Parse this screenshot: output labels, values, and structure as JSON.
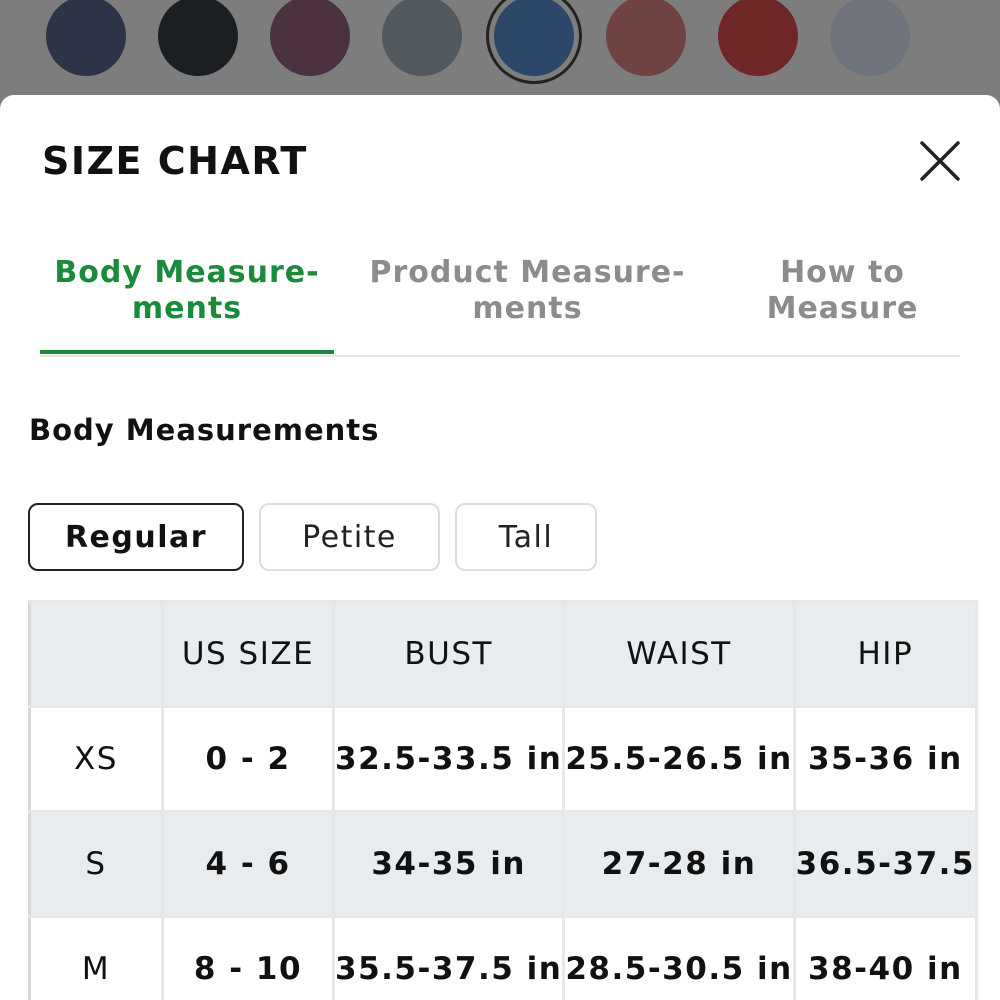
{
  "colors": {
    "accent": "#1a8a3c",
    "swatches": [
      "#2e3448",
      "#1c1f21",
      "#4c3140",
      "#51595f",
      "#2c4869",
      "#6e4342",
      "#6f2627",
      "#6f737b"
    ]
  },
  "swatches": {
    "selected_index": 4
  },
  "size_chart": {
    "title": "SIZE CHART",
    "close_icon": "close-icon"
  },
  "tabs": [
    {
      "label": "Body Measure-\nments",
      "active": true
    },
    {
      "label": "Product Measure-\nments",
      "active": false
    },
    {
      "label": "How to\nMeasure",
      "active": false
    }
  ],
  "section_title": "Body Measurements",
  "fit_options": [
    {
      "label": "Regular",
      "active": true
    },
    {
      "label": "Petite",
      "active": false
    },
    {
      "label": "Tall",
      "active": false
    }
  ],
  "table": {
    "headers": [
      "",
      "US SIZE",
      "BUST",
      "WAIST",
      "HIP"
    ],
    "rows": [
      [
        "XS",
        "0 - 2",
        "32.5-33.5 in",
        "25.5-26.5 in",
        "35-36 in"
      ],
      [
        "S",
        "4 - 6",
        "34-35 in",
        "27-28 in",
        "36.5-37.5"
      ],
      [
        "M",
        "8 - 10",
        "35.5-37.5 in",
        "28.5-30.5 in",
        "38-40 in"
      ]
    ]
  }
}
